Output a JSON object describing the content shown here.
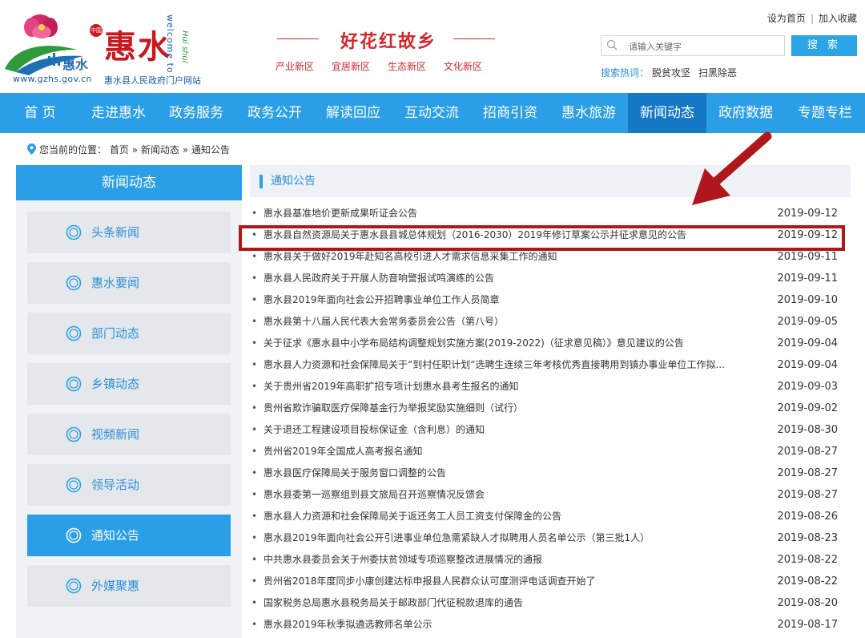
{
  "header": {
    "logo": {
      "url": "www.gzhs.gov.cn",
      "name": "惠水县人民政府门户网站",
      "huishui": "惠水",
      "zhongguo": "中国",
      "welcome": "welcome to",
      "pinyin": "Hui shui"
    },
    "slogan": {
      "title": "好花红故乡",
      "tags": [
        "产业新区",
        "宜居新区",
        "生态新区",
        "文化新区"
      ]
    },
    "top_links": [
      "设为首页",
      "加入收藏"
    ],
    "search": {
      "placeholder": "请输入关键字",
      "button": "搜 索",
      "hotwords_label": "搜索热词：",
      "hotwords": [
        "脱贫攻坚",
        "扫黑除恶"
      ]
    }
  },
  "nav": {
    "items": [
      "首 页",
      "走进惠水",
      "政务服务",
      "政务公开",
      "解读回应",
      "互动交流",
      "招商引资",
      "惠水旅游",
      "新闻动态",
      "政府数据",
      "专题专栏"
    ],
    "active": "新闻动态"
  },
  "breadcrumb": {
    "prefix": "您当前的位置：",
    "path": [
      "首页",
      "新闻动态",
      "通知公告"
    ],
    "separator": "»"
  },
  "sidebar": {
    "title": "新闻动态",
    "items": [
      "头条新闻",
      "惠水要闻",
      "部门动态",
      "乡镇动态",
      "视频新闻",
      "领导活动",
      "通知公告",
      "外媒聚惠"
    ],
    "active": "通知公告"
  },
  "content": {
    "title": "通知公告",
    "bullet": "•",
    "news": [
      {
        "title": "惠水县基准地价更新成果听证会公告",
        "date": "2019-09-12"
      },
      {
        "title": "惠水县自然资源局关于惠水县县城总体规划（2016-2030）2019年修订草案公示并征求意见的公告",
        "date": "2019-09-12"
      },
      {
        "title": "惠水县关于做好2019年赴知名高校引进人才需求信息采集工作的通知",
        "date": "2019-09-11"
      },
      {
        "title": "惠水县人民政府关于开展人防音响警报试鸣演练的公告",
        "date": "2019-09-11"
      },
      {
        "title": "惠水县2019年面向社会公开招聘事业单位工作人员简章",
        "date": "2019-09-10"
      },
      {
        "title": "惠水县第十八届人民代表大会常务委员会公告（第八号）",
        "date": "2019-09-05"
      },
      {
        "title": "关于征求《惠水县中小学布局结构调整规划实施方案(2019-2022)（征求意见稿）》意见建议的公告",
        "date": "2019-09-04"
      },
      {
        "title": "惠水县人力资源和社会保障局关于“到村任职计划”选聘生连续三年考核优秀直接聘用到镇办事业单位工作拟...",
        "date": "2019-09-04"
      },
      {
        "title": "关于贵州省2019年高职扩招专项计划惠水县考生报名的通知",
        "date": "2019-09-03"
      },
      {
        "title": "贵州省欺诈骗取医疗保障基金行为举报奖励实施细则（试行）",
        "date": "2019-09-02"
      },
      {
        "title": "关于退还工程建设项目投标保证金（含利息）的通知",
        "date": "2019-08-30"
      },
      {
        "title": "贵州省2019年全国成人高考报名通知",
        "date": "2019-08-27"
      },
      {
        "title": "惠水县医疗保障局关于服务窗口调整的公告",
        "date": "2019-08-27"
      },
      {
        "title": "惠水县委第一巡察组到县文旅局召开巡察情况反馈会",
        "date": "2019-08-27"
      },
      {
        "title": "惠水县人力资源和社会保障局关于返还务工人员工资支付保障金的公告",
        "date": "2019-08-26"
      },
      {
        "title": "惠水县2019年面向社会公开引进事业单位急需紧缺人才拟聘用人员名单公示（第三批1人）",
        "date": "2019-08-23"
      },
      {
        "title": "中共惠水县委员会关于州委扶贫领域专项巡察整改进展情况的通报",
        "date": "2019-08-22"
      },
      {
        "title": "贵州省2018年度同步小康创建达标申报县人民群众认可度测评电话调查开始了",
        "date": "2019-08-22"
      },
      {
        "title": "国家税务总局惠水县税务局关于邮政部门代征税款退库的通告",
        "date": "2019-08-20"
      },
      {
        "title": "惠水县2019年秋季拟遴选教师名单公示",
        "date": "2019-08-17"
      }
    ]
  },
  "colors": {
    "nav_bg": "#2a9ee6",
    "nav_active": "#1578c5",
    "brand_red": "#d8252c",
    "highlight": "#b0171c",
    "link_blue": "#2a8fd6"
  }
}
